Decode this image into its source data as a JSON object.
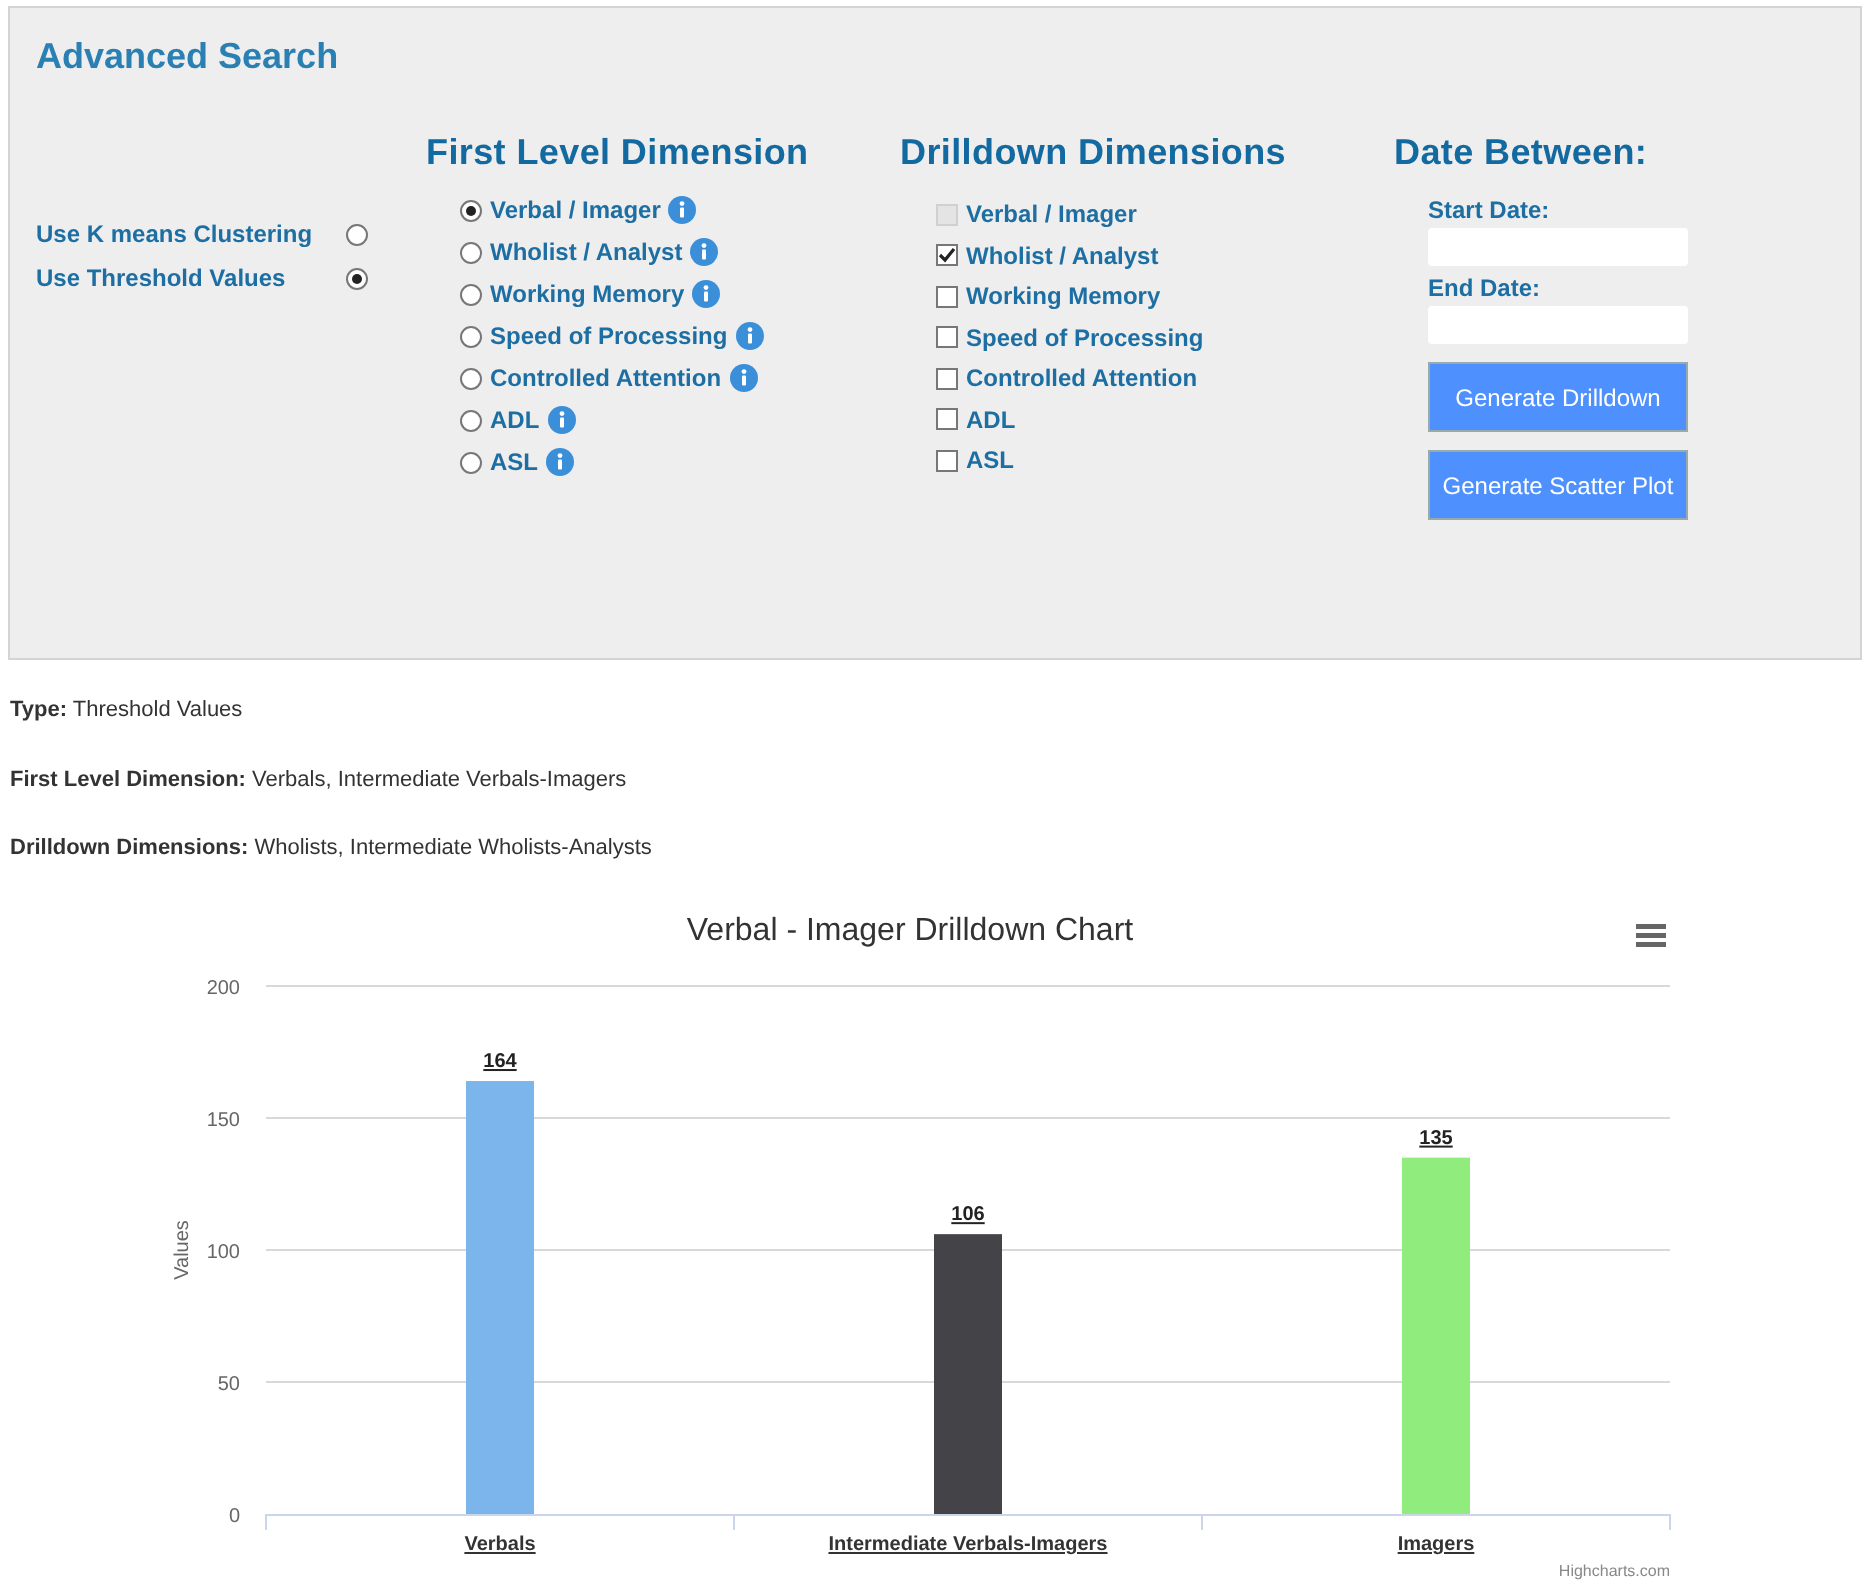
{
  "panel": {
    "title": "Advanced Search",
    "modes": [
      {
        "label": "Use K means Clustering",
        "selected": false
      },
      {
        "label": "Use Threshold Values",
        "selected": true
      }
    ],
    "first_level": {
      "heading": "First Level Dimension",
      "options": [
        {
          "label": "Verbal / Imager",
          "selected": true
        },
        {
          "label": "Wholist / Analyst",
          "selected": false
        },
        {
          "label": "Working Memory",
          "selected": false
        },
        {
          "label": "Speed of Processing",
          "selected": false
        },
        {
          "label": "Controlled Attention",
          "selected": false
        },
        {
          "label": "ADL",
          "selected": false
        },
        {
          "label": "ASL",
          "selected": false
        }
      ]
    },
    "drilldown": {
      "heading": "Drilldown Dimensions",
      "options": [
        {
          "label": "Verbal / Imager",
          "checked": false,
          "disabled": true
        },
        {
          "label": "Wholist / Analyst",
          "checked": true,
          "disabled": false
        },
        {
          "label": "Working Memory",
          "checked": false,
          "disabled": false
        },
        {
          "label": "Speed of Processing",
          "checked": false,
          "disabled": false
        },
        {
          "label": "Controlled Attention",
          "checked": false,
          "disabled": false
        },
        {
          "label": "ADL",
          "checked": false,
          "disabled": false
        },
        {
          "label": "ASL",
          "checked": false,
          "disabled": false
        }
      ]
    },
    "dates": {
      "heading": "Date Between:",
      "fields": [
        {
          "label": "Start Date:"
        },
        {
          "label": "End Date:"
        }
      ],
      "buttons": [
        "Generate Drilldown",
        "Generate Scatter Plot"
      ]
    }
  },
  "summary": [
    {
      "label": "Type:",
      "value": "Threshold Values"
    },
    {
      "label": "First Level Dimension:",
      "value": "Verbals, Intermediate Verbals-Imagers"
    },
    {
      "label": "Drilldown Dimensions:",
      "value": "Wholists, Intermediate Wholists-Analysts"
    }
  ],
  "chart": {
    "credit": "Highcharts.com",
    "chart_data": {
      "type": "bar",
      "title": "Verbal - Imager Drilldown Chart",
      "ylabel": "Values",
      "categories": [
        "Verbals",
        "Intermediate Verbals-Imagers",
        "Imagers"
      ],
      "values": [
        164,
        106,
        135
      ],
      "ylim": [
        0,
        200
      ],
      "yticks": [
        0,
        50,
        100,
        150,
        200
      ],
      "grid": true,
      "data_labels": true
    }
  }
}
